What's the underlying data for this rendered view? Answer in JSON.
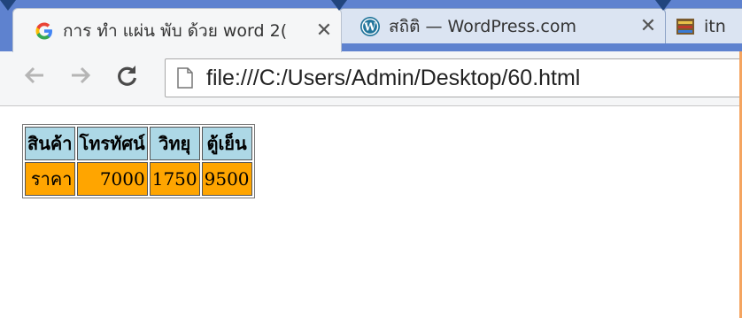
{
  "tabs": [
    {
      "title": "การ ทำ แผ่น พับ ด้วย word 2(",
      "favicon": "google-icon",
      "active": true
    },
    {
      "title": "สถิติ — WordPress.com",
      "favicon": "wordpress-icon",
      "active": false
    },
    {
      "title": "itn",
      "favicon": "page-icon",
      "active": false
    }
  ],
  "toolbar": {
    "url": "file:///C:/Users/Admin/Desktop/60.html"
  },
  "table": {
    "headers": [
      "สินค้า",
      "โทรทัศน์",
      "วิทยุ",
      "ตู้เย็น"
    ],
    "row": [
      "ราคา",
      "7000",
      "1750",
      "9500"
    ]
  },
  "colors": {
    "header_bg": "#add8e6",
    "value_bg": "#ffa500",
    "tabstrip": "#5e82cf"
  }
}
